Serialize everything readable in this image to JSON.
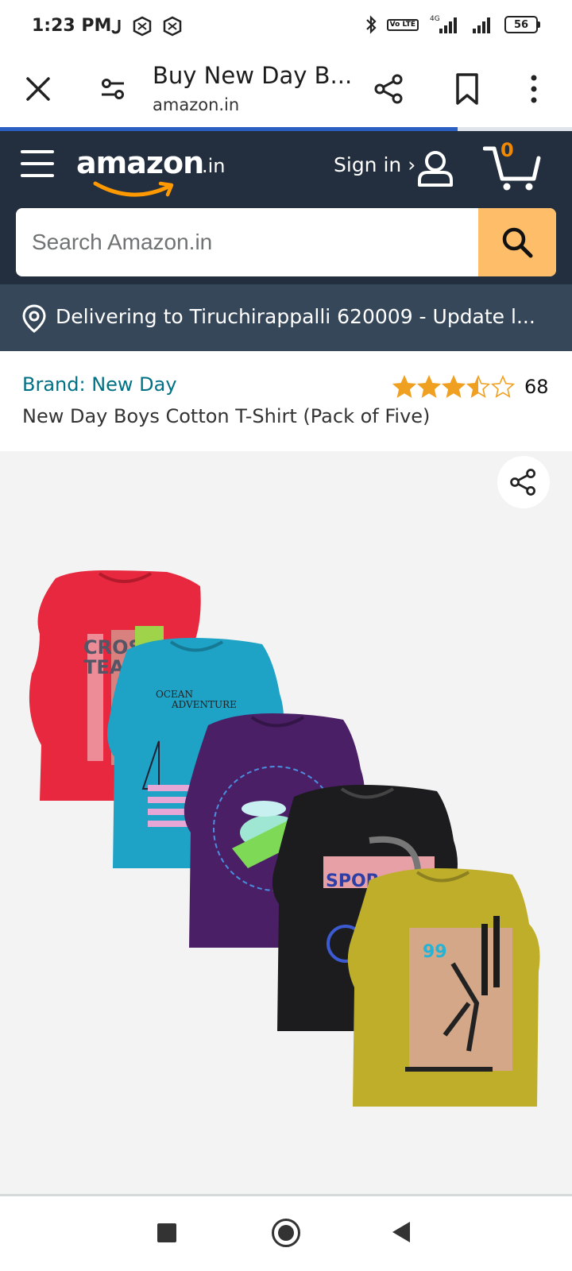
{
  "status_bar": {
    "time": "1:23 PM",
    "network_label": "4G",
    "volte_label": "Vo LTE",
    "battery": "56"
  },
  "browser": {
    "title": "Buy New Day B...",
    "domain": "amazon.in",
    "load_progress_percent": 80
  },
  "amazon_header": {
    "logo_word": "amazon",
    "logo_tld": ".in",
    "sign_in": "Sign in ›",
    "cart_count": "0",
    "search_placeholder": "Search Amazon.in"
  },
  "delivery": {
    "text": "Delivering to Tiruchirappalli 620009 - Update l..."
  },
  "product": {
    "brand": "Brand: New Day",
    "title": "New Day Boys Cotton T-Shirt (Pack of Five)",
    "rating_stars": 3.5,
    "rating_count": "68"
  },
  "colors": {
    "nav_dark": "#232f3e",
    "deliver_bar": "#37475a",
    "search_button": "#febd69",
    "link_teal": "#007185",
    "star_orange": "#f0a020",
    "cart_badge": "#f08804"
  },
  "icons": {
    "close": "close-icon",
    "site_settings": "tune-icon",
    "share": "share-icon",
    "bookmark": "bookmark-icon",
    "more": "more-vertical-icon",
    "menu": "hamburger-menu-icon",
    "account": "user-icon",
    "cart": "cart-icon",
    "search": "magnifier-icon",
    "location": "location-pin-icon"
  }
}
